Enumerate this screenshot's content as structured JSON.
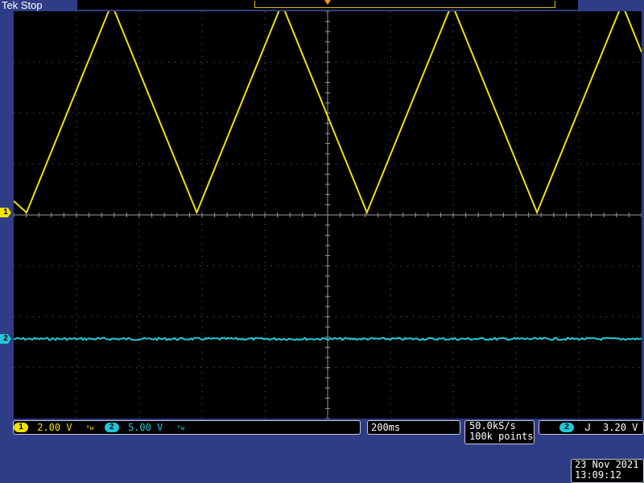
{
  "header": {
    "brand": "Tek",
    "state": "Stop"
  },
  "channels": [
    {
      "id": "1",
      "scale": "2.00 V",
      "color": "#f2e200"
    },
    {
      "id": "2",
      "scale": "5.00 V",
      "color": "#22c7d8"
    }
  ],
  "bandwidth_symbol": "ᴮw",
  "timebase": "200ms",
  "acquisition": {
    "sample_rate": "50.0kS/s",
    "record_length": "100k points"
  },
  "trigger": {
    "source": "2",
    "slope_symbol": "ᒍ",
    "level": "3.20 V"
  },
  "timestamp": {
    "date": "23 Nov 2021",
    "time": "13:09:12"
  },
  "chart_data": {
    "type": "line",
    "xlim": [
      -1.0,
      1.0
    ],
    "x_unit": "s",
    "grid": {
      "x_divisions": 10,
      "y_divisions": 8
    },
    "series": [
      {
        "channel": "1",
        "color": "#f2e200",
        "unit": "V",
        "vertical_scale_per_div": 2.0,
        "x": [
          -1.0,
          -0.959,
          -0.688,
          -0.417,
          -0.146,
          0.125,
          0.396,
          0.667,
          0.938,
          1.0
        ],
        "y": [
          0.45,
          0.0,
          8.2,
          0.0,
          8.2,
          0.0,
          8.2,
          0.0,
          8.2,
          6.3
        ]
      },
      {
        "channel": "2",
        "color": "#22c7d8",
        "unit": "V",
        "vertical_scale_per_div": 5.0,
        "x": [
          -1.0,
          1.0
        ],
        "y": [
          0.0,
          0.0
        ]
      }
    ]
  }
}
